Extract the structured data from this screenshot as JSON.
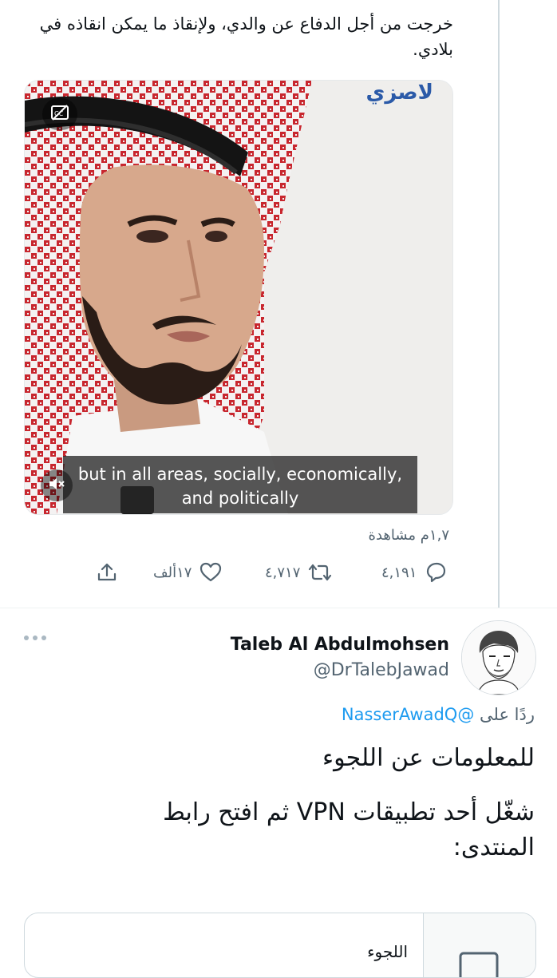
{
  "tweet": {
    "text": "خرجت من أجل الدفاع عن والدي، ولإنقاذ ما يمكن انقاذه في بلادي.",
    "video": {
      "brand_logo": "لاصزي",
      "caption_line1": "but in all areas, socially, economically,",
      "caption_line2": "and politically"
    },
    "views": "١,٧م مشاهدة",
    "stats": {
      "replies": "٤,١٩١",
      "retweets": "٤,٧١٧",
      "likes": "١٧ألف"
    }
  },
  "reply": {
    "author_name": "Taleb Al Abdulmohsen",
    "author_handle": "@DrTalebJawad",
    "replying_prefix": "ردًا على",
    "replying_to": "@NasserAwadQ",
    "line1": "للمعلومات عن اللجوء",
    "line2": "شغّل أحد تطبيقات VPN ثم افتح رابط المنتدى:",
    "card_title": "اللجوء"
  },
  "colors": {
    "accent": "#1d9bf0",
    "secondary_text": "#536471",
    "divider": "#eff3f4"
  },
  "icons": [
    "closed-captions-off-icon",
    "mute-icon",
    "reply-icon",
    "retweet-icon",
    "like-icon",
    "share-icon",
    "more-icon"
  ]
}
